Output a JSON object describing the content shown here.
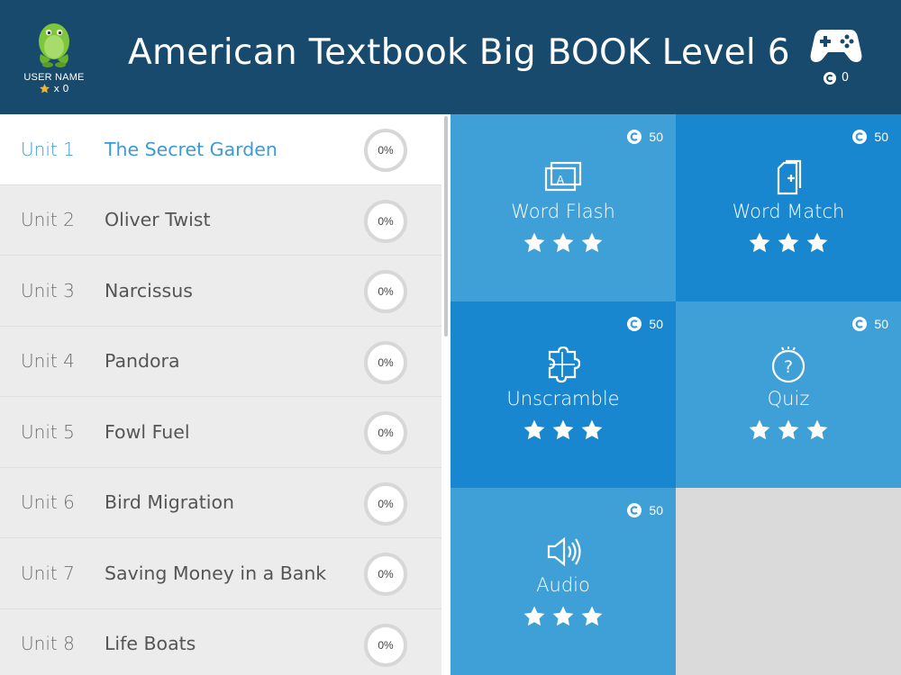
{
  "header": {
    "title": "American Textbook Big BOOK Level 6",
    "user_name": "USER NAME",
    "user_star_count": "x 0",
    "coin_count": "0"
  },
  "units": [
    {
      "num": "Unit 1",
      "title": "The Secret Garden",
      "progress": "0%",
      "active": true
    },
    {
      "num": "Unit 2",
      "title": "Oliver Twist",
      "progress": "0%",
      "active": false
    },
    {
      "num": "Unit 3",
      "title": "Narcissus",
      "progress": "0%",
      "active": false
    },
    {
      "num": "Unit 4",
      "title": "Pandora",
      "progress": "0%",
      "active": false
    },
    {
      "num": "Unit 5",
      "title": "Fowl Fuel",
      "progress": "0%",
      "active": false
    },
    {
      "num": "Unit 6",
      "title": "Bird Migration",
      "progress": "0%",
      "active": false
    },
    {
      "num": "Unit 7",
      "title": "Saving Money in a Bank",
      "progress": "0%",
      "active": false
    },
    {
      "num": "Unit 8",
      "title": "Life Boats",
      "progress": "0%",
      "active": false
    }
  ],
  "activities": [
    {
      "label": "Word Flash",
      "cost": "50",
      "icon": "flashcard-icon",
      "stars": 3
    },
    {
      "label": "Word Match",
      "cost": "50",
      "icon": "card-add-icon",
      "stars": 3
    },
    {
      "label": "Unscramble",
      "cost": "50",
      "icon": "puzzle-icon",
      "stars": 3
    },
    {
      "label": "Quiz",
      "cost": "50",
      "icon": "question-icon",
      "stars": 3
    },
    {
      "label": "Audio",
      "cost": "50",
      "icon": "speaker-icon",
      "stars": 3
    }
  ],
  "colors": {
    "header_bg": "#174a6c",
    "active_text": "#3d9ad8",
    "tile_light": "#3f9fd7",
    "tile_dark": "#1987cf",
    "star_user": "#f2b233"
  }
}
